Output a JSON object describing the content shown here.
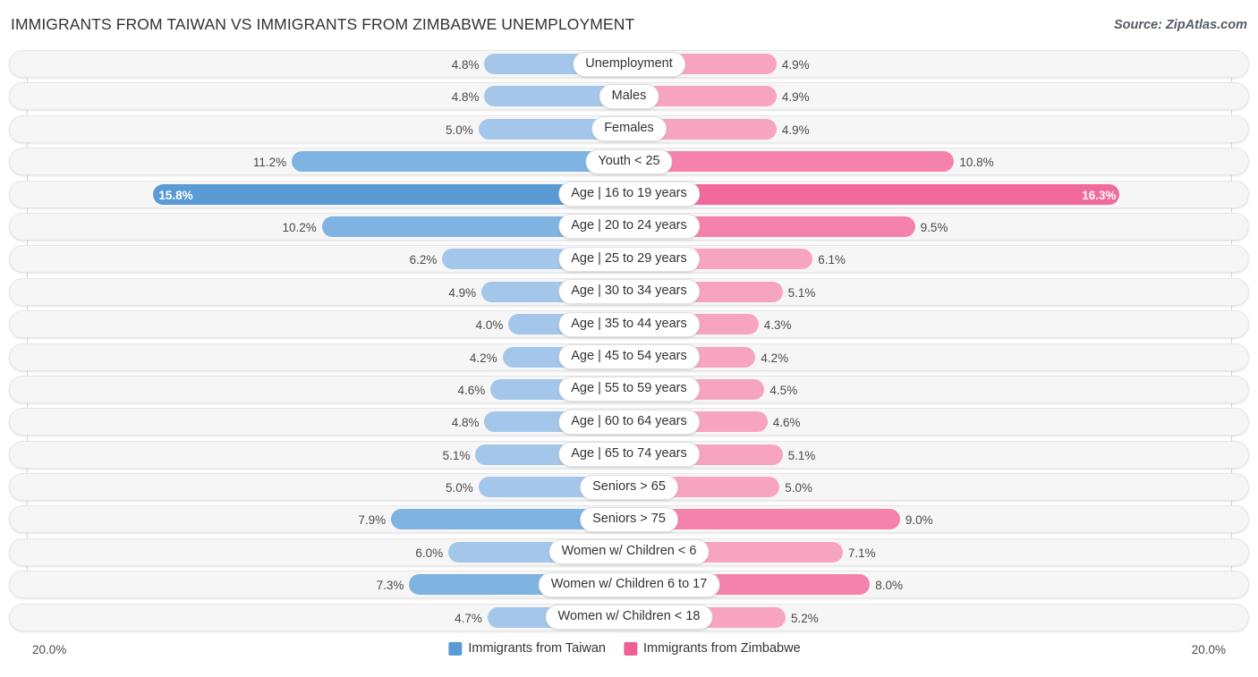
{
  "header": {
    "title": "IMMIGRANTS FROM TAIWAN VS IMMIGRANTS FROM ZIMBABWE UNEMPLOYMENT",
    "source": "Source: ZipAtlas.com"
  },
  "axis": {
    "left_max_label": "20.0%",
    "right_max_label": "20.0%",
    "max": 20.0
  },
  "legend": {
    "items": [
      {
        "label": "Immigrants from Taiwan",
        "color": "#5b9bd5"
      },
      {
        "label": "Immigrants from Zimbabwe",
        "color": "#ef5f93"
      }
    ]
  },
  "chart_data": {
    "type": "bar",
    "title": "IMMIGRANTS FROM TAIWAN VS IMMIGRANTS FROM ZIMBABWE UNEMPLOYMENT",
    "subtitle": "",
    "orientation": "horizontal-diverging",
    "xlabel": "",
    "ylabel": "",
    "xlim": [
      0,
      20
    ],
    "grid": true,
    "legend_position": "bottom-center",
    "axis_max_label": "20.0%",
    "categories": [
      "Unemployment",
      "Males",
      "Females",
      "Youth < 25",
      "Age | 16 to 19 years",
      "Age | 20 to 24 years",
      "Age | 25 to 29 years",
      "Age | 30 to 34 years",
      "Age | 35 to 44 years",
      "Age | 45 to 54 years",
      "Age | 55 to 59 years",
      "Age | 60 to 64 years",
      "Age | 65 to 74 years",
      "Seniors > 65",
      "Seniors > 75",
      "Women w/ Children < 6",
      "Women w/ Children 6 to 17",
      "Women w/ Children < 18"
    ],
    "series": [
      {
        "name": "Immigrants from Taiwan",
        "color": "#5b9bd5",
        "values": [
          4.8,
          4.8,
          5.0,
          11.2,
          15.8,
          10.2,
          6.2,
          4.9,
          4.0,
          4.2,
          4.6,
          4.8,
          5.1,
          5.0,
          7.9,
          6.0,
          7.3,
          4.7
        ],
        "labels": [
          "4.8%",
          "4.8%",
          "5.0%",
          "11.2%",
          "15.8%",
          "10.2%",
          "6.2%",
          "4.9%",
          "4.0%",
          "4.2%",
          "4.6%",
          "4.8%",
          "5.1%",
          "5.0%",
          "7.9%",
          "6.0%",
          "7.3%",
          "4.7%"
        ]
      },
      {
        "name": "Immigrants from Zimbabwe",
        "color": "#ef5f93",
        "values": [
          4.9,
          4.9,
          4.9,
          10.8,
          16.3,
          9.5,
          6.1,
          5.1,
          4.3,
          4.2,
          4.5,
          4.6,
          5.1,
          5.0,
          9.0,
          7.1,
          8.0,
          5.2
        ],
        "labels": [
          "4.9%",
          "4.9%",
          "4.9%",
          "10.8%",
          "16.3%",
          "9.5%",
          "6.1%",
          "5.1%",
          "4.3%",
          "4.2%",
          "4.5%",
          "4.6%",
          "5.1%",
          "5.0%",
          "9.0%",
          "7.1%",
          "8.0%",
          "5.2%"
        ]
      }
    ]
  },
  "rows": [
    {
      "category": "Unemployment",
      "left_label": "4.8%",
      "left_value": 4.8,
      "right_label": "4.9%",
      "right_value": 4.9,
      "intensity": "low"
    },
    {
      "category": "Males",
      "left_label": "4.8%",
      "left_value": 4.8,
      "right_label": "4.9%",
      "right_value": 4.9,
      "intensity": "low"
    },
    {
      "category": "Females",
      "left_label": "5.0%",
      "left_value": 5.0,
      "right_label": "4.9%",
      "right_value": 4.9,
      "intensity": "low"
    },
    {
      "category": "Youth < 25",
      "left_label": "11.2%",
      "left_value": 11.2,
      "right_label": "10.8%",
      "right_value": 10.8,
      "intensity": "mid"
    },
    {
      "category": "Age | 16 to 19 years",
      "left_label": "15.8%",
      "left_value": 15.8,
      "right_label": "16.3%",
      "right_value": 16.3,
      "intensity": "high"
    },
    {
      "category": "Age | 20 to 24 years",
      "left_label": "10.2%",
      "left_value": 10.2,
      "right_label": "9.5%",
      "right_value": 9.5,
      "intensity": "mid"
    },
    {
      "category": "Age | 25 to 29 years",
      "left_label": "6.2%",
      "left_value": 6.2,
      "right_label": "6.1%",
      "right_value": 6.1,
      "intensity": "low"
    },
    {
      "category": "Age | 30 to 34 years",
      "left_label": "4.9%",
      "left_value": 4.9,
      "right_label": "5.1%",
      "right_value": 5.1,
      "intensity": "low"
    },
    {
      "category": "Age | 35 to 44 years",
      "left_label": "4.0%",
      "left_value": 4.0,
      "right_label": "4.3%",
      "right_value": 4.3,
      "intensity": "low"
    },
    {
      "category": "Age | 45 to 54 years",
      "left_label": "4.2%",
      "left_value": 4.2,
      "right_label": "4.2%",
      "right_value": 4.2,
      "intensity": "low"
    },
    {
      "category": "Age | 55 to 59 years",
      "left_label": "4.6%",
      "left_value": 4.6,
      "right_label": "4.5%",
      "right_value": 4.5,
      "intensity": "low"
    },
    {
      "category": "Age | 60 to 64 years",
      "left_label": "4.8%",
      "left_value": 4.8,
      "right_label": "4.6%",
      "right_value": 4.6,
      "intensity": "low"
    },
    {
      "category": "Age | 65 to 74 years",
      "left_label": "5.1%",
      "left_value": 5.1,
      "right_label": "5.1%",
      "right_value": 5.1,
      "intensity": "low"
    },
    {
      "category": "Seniors > 65",
      "left_label": "5.0%",
      "left_value": 5.0,
      "right_label": "5.0%",
      "right_value": 5.0,
      "intensity": "low"
    },
    {
      "category": "Seniors > 75",
      "left_label": "7.9%",
      "left_value": 7.9,
      "right_label": "9.0%",
      "right_value": 9.0,
      "intensity": "mid"
    },
    {
      "category": "Women w/ Children < 6",
      "left_label": "6.0%",
      "left_value": 6.0,
      "right_label": "7.1%",
      "right_value": 7.1,
      "intensity": "low"
    },
    {
      "category": "Women w/ Children 6 to 17",
      "left_label": "7.3%",
      "left_value": 7.3,
      "right_label": "8.0%",
      "right_value": 8.0,
      "intensity": "mid"
    },
    {
      "category": "Women w/ Children < 18",
      "left_label": "4.7%",
      "left_value": 4.7,
      "right_label": "5.2%",
      "right_value": 5.2,
      "intensity": "low"
    }
  ]
}
